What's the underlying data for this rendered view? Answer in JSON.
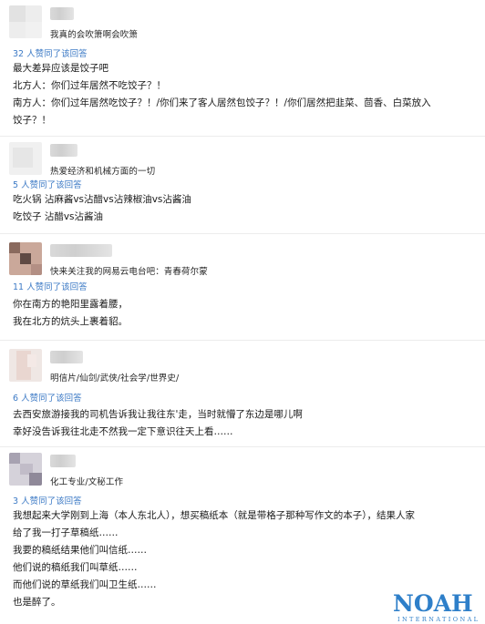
{
  "answers": [
    {
      "bio": "我真的会吹箫啊会吹箫",
      "votes": "32 人赞同了该回答",
      "lines": [
        "最大差异应该是饺子吧",
        "北方人：你们过年居然不吃饺子？！",
        "南方人：你们过年居然吃饺子？！/你们来了客人居然包饺子？！/你们居然把韭菜、茴香、白菜放入",
        "饺子？！"
      ]
    },
    {
      "bio": "热爱经济和机械方面的一切",
      "votes": "5 人赞同了该回答",
      "lines": [
        "吃火锅 沾麻酱vs沾醋vs沾辣椒油vs沾酱油",
        "吃饺子 沾醋vs沾酱油"
      ]
    },
    {
      "bio": "快来关注我的网易云电台吧：青春荷尔蒙",
      "votes": "11 人赞同了该回答",
      "lines": [
        "你在南方的艳阳里露着腰，",
        "我在北方的炕头上裹着貂。"
      ]
    },
    {
      "bio": "明信片/仙剑/武侠/社会学/世界史/",
      "votes": "6 人赞同了该回答",
      "lines": [
        "去西安旅游接我的司机告诉我让我往东'走，当时就懵了东边是哪儿啊",
        "幸好没告诉我往北走不然我一定下意识往天上看……"
      ]
    },
    {
      "bio": "化工专业/文秘工作",
      "votes": "3 人赞同了该回答",
      "lines": [
        "我想起来大学刚到上海（本人东北人），想买稿纸本（就是带格子那种写作文的本子），结果人家",
        "给了我一打子草稿纸……",
        "我要的稿纸结果他们叫信纸……",
        "他们说的稿纸我们叫草纸……",
        "而他们说的草纸我们叫卫生纸……",
        "也是醉了。"
      ]
    }
  ],
  "watermark": {
    "main": "NOAH",
    "sub": "INTERNATIONAL",
    "color": "#2e7fc9"
  },
  "colors": {
    "vote_link": "#3e7bc6",
    "divider": "#ececec"
  }
}
